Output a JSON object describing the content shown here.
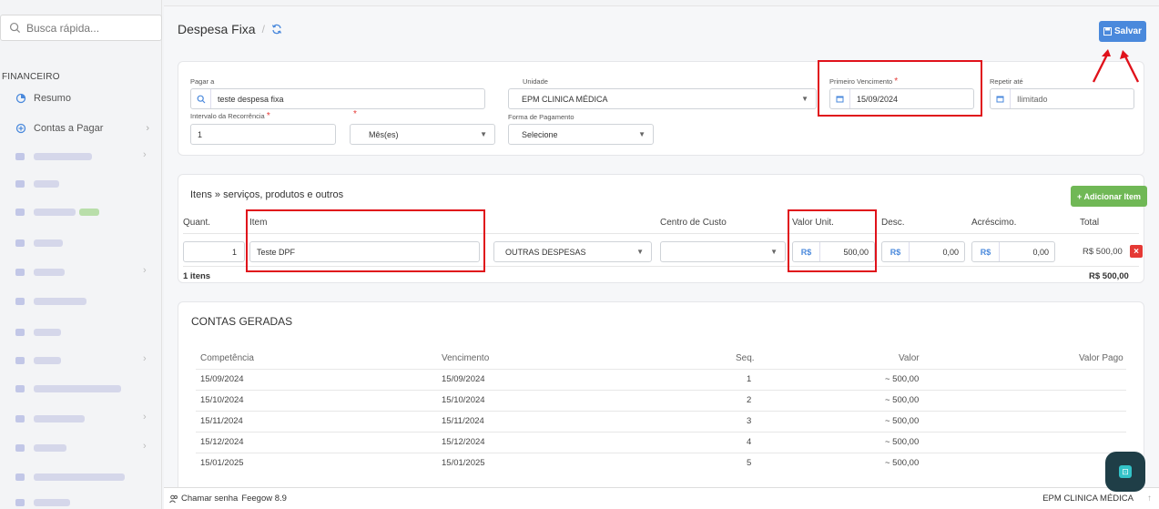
{
  "sidebar": {
    "search_placeholder": "Busca rápida...",
    "section": "FINANCEIRO",
    "items": [
      {
        "label": "Resumo",
        "icon": "pie-chart-icon"
      },
      {
        "label": "Contas a Pagar",
        "icon": "plus-circle-icon",
        "has_children": true
      }
    ]
  },
  "header": {
    "title": "Despesa Fixa",
    "separator": "/",
    "save_label": "Salvar"
  },
  "form": {
    "pagar_a_label": "Pagar a",
    "pagar_a_value": "teste despesa fixa",
    "unidade_label": "Unidade",
    "unidade_value": "EPM CLINICA MÉDICA",
    "primeiro_venc_label": "Primeiro Vencimento",
    "primeiro_venc_value": "15/09/2024",
    "repetir_label": "Repetir até",
    "repetir_value": "Ilimitado",
    "intervalo_label": "Intervalo da Recorrência",
    "intervalo_value": "1",
    "periodo_value": "Mês(es)",
    "forma_label": "Forma de Pagamento",
    "forma_value": "Selecione",
    "required_mark": "*"
  },
  "items": {
    "title": "Itens » serviços, produtos e outros",
    "add_label": "+ Adicionar Item",
    "columns": {
      "quant": "Quant.",
      "item": "Item",
      "centro": "Centro de Custo",
      "valor": "Valor Unit.",
      "desc": "Desc.",
      "acresc": "Acréscimo.",
      "total": "Total"
    },
    "row": {
      "quant": "1",
      "item": "Teste DPF",
      "categoria": "OUTRAS DESPESAS",
      "centro": "",
      "currency": "R$",
      "valor": "500,00",
      "desc": "0,00",
      "acresc": "0,00",
      "total": "R$ 500,00",
      "delete": "×"
    },
    "count": "1 itens",
    "sum": "R$ 500,00"
  },
  "contas": {
    "title": "CONTAS GERADAS",
    "headers": [
      "Competência",
      "Vencimento",
      "Seq.",
      "Valor",
      "Valor Pago"
    ],
    "rows": [
      {
        "competencia": "15/09/2024",
        "vencimento": "15/09/2024",
        "seq": "1",
        "valor": "~ 500,00"
      },
      {
        "competencia": "15/10/2024",
        "vencimento": "15/10/2024",
        "seq": "2",
        "valor": "~ 500,00"
      },
      {
        "competencia": "15/11/2024",
        "vencimento": "15/11/2024",
        "seq": "3",
        "valor": "~ 500,00"
      },
      {
        "competencia": "15/12/2024",
        "vencimento": "15/12/2024",
        "seq": "4",
        "valor": "~ 500,00"
      },
      {
        "competencia": "15/01/2025",
        "vencimento": "15/01/2025",
        "seq": "5",
        "valor": "~ 500,00"
      }
    ]
  },
  "footer": {
    "chamar_senha": "Chamar senha",
    "version": "Feegow 8.9",
    "unidade": "EPM CLINICA MÉDICA"
  },
  "colors": {
    "accent": "#4a89dc",
    "success": "#70b856",
    "danger": "#e53935",
    "highlight": "#e0121b"
  }
}
